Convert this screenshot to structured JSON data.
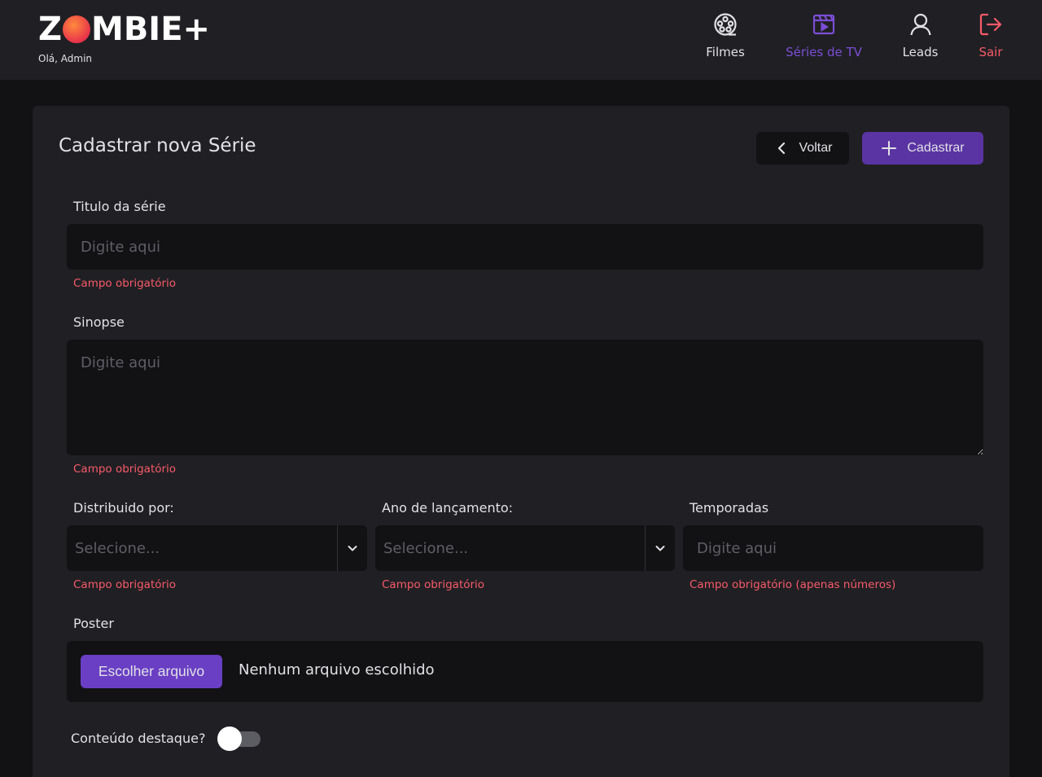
{
  "header": {
    "logo_left": "Z",
    "logo_right": "MBIE+",
    "greeting": "Olá, Admin"
  },
  "nav": {
    "items": [
      {
        "label": "Filmes",
        "icon": "film-reel-icon",
        "color": "#e1e1e6"
      },
      {
        "label": "Séries de TV",
        "icon": "clapperboard-icon",
        "color": "#7c4dd6",
        "active": true
      },
      {
        "label": "Leads",
        "icon": "user-icon",
        "color": "#e1e1e6"
      },
      {
        "label": "Sair",
        "icon": "logout-icon",
        "color": "#f75a68"
      }
    ]
  },
  "page": {
    "title": "Cadastrar nova Série",
    "back_label": "Voltar",
    "submit_label": "Cadastrar"
  },
  "form": {
    "title_label": "Titulo da série",
    "title_placeholder": "Digite aqui",
    "title_error": "Campo obrigatório",
    "synopsis_label": "Sinopse",
    "synopsis_placeholder": "Digite aqui",
    "synopsis_error": "Campo obrigatório",
    "distributor_label": "Distribuido por:",
    "distributor_value": "Selecione...",
    "distributor_error": "Campo obrigatório",
    "year_label": "Ano de lançamento:",
    "year_value": "Selecione...",
    "year_error": "Campo obrigatório",
    "seasons_label": "Temporadas",
    "seasons_placeholder": "Digite aqui",
    "seasons_error": "Campo obrigatório (apenas números)",
    "poster_label": "Poster",
    "poster_button": "Escolher arquivo",
    "poster_status": "Nenhum arquivo escolhido",
    "featured_label": "Conteúdo destaque?",
    "featured_on": false
  },
  "colors": {
    "accent": "#5b34a3",
    "error": "#f75a68",
    "background": "#121214",
    "surface": "#202024"
  }
}
